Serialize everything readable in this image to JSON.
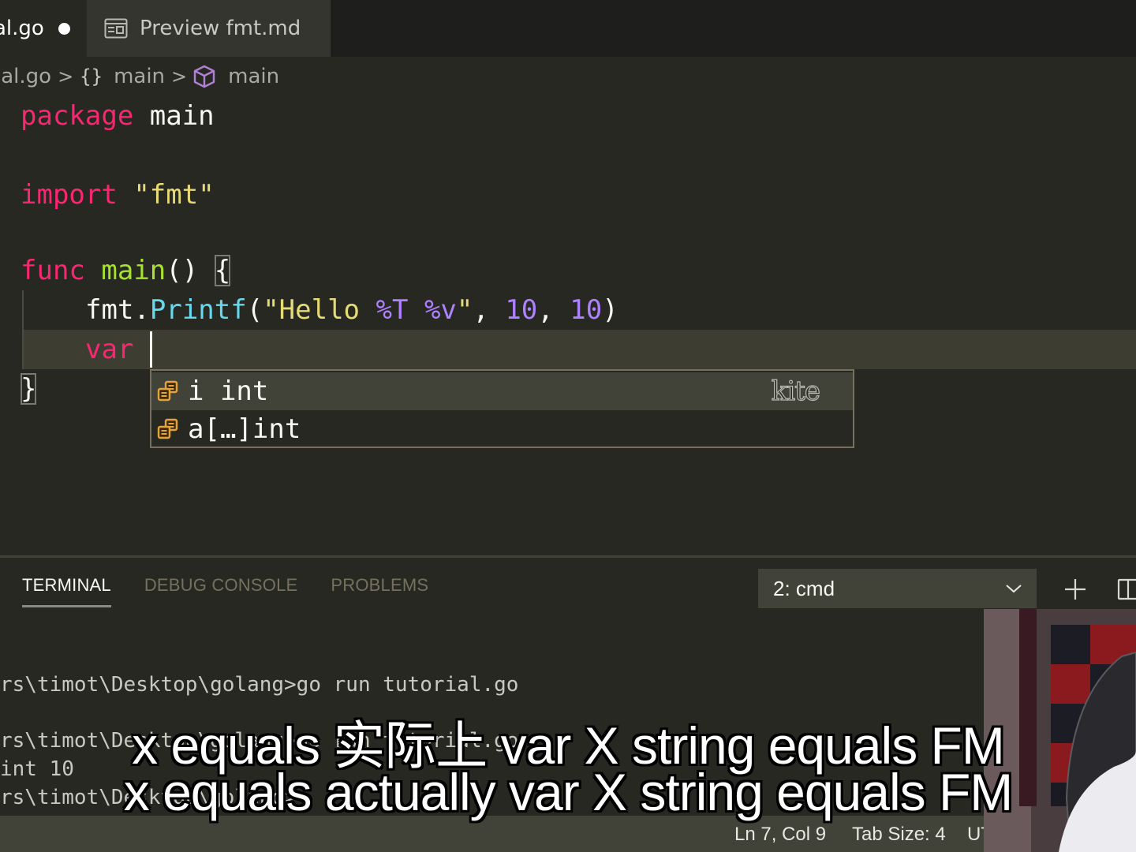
{
  "tabs": [
    {
      "label": "al.go",
      "dirty": true,
      "active": true
    },
    {
      "label": "Preview fmt.md",
      "icon": "preview-icon",
      "active": false
    }
  ],
  "breadcrumb": {
    "file": "ial.go",
    "separator": ">",
    "namespace_icon": "{}",
    "namespace": "main",
    "symbol": "main"
  },
  "editor": {
    "lines": {
      "l1": {
        "kw": "package",
        "rest": " main"
      },
      "l3": {
        "kw": "import",
        "str": "\"fmt\""
      },
      "l5": {
        "kw": "func",
        "fn": "main",
        "parens": "()",
        "brace": "{"
      },
      "l6": {
        "obj": "fmt.",
        "method": "Printf",
        "open": "(",
        "str": "\"Hello ",
        "verb1": "%T",
        "space": " ",
        "verb2": "%v",
        "strEnd": "\"",
        "comma1": ", ",
        "n1": "10",
        "comma2": ", ",
        "n2": "10",
        "close": ")"
      },
      "l7": {
        "kw": "var",
        "rest": " "
      },
      "l8": {
        "brace": "}"
      }
    }
  },
  "suggestions": [
    {
      "label": "i int",
      "source": "kite",
      "icon": "variable-icon",
      "selected": true
    },
    {
      "label": "a[…]int",
      "source": "",
      "icon": "variable-icon",
      "selected": false
    }
  ],
  "panel": {
    "tabs": [
      "TERMINAL",
      "DEBUG CONSOLE",
      "PROBLEMS"
    ],
    "active_tab": "TERMINAL",
    "terminal_select": "2: cmd",
    "terminal_lines": [
      "rs\\timot\\Desktop\\golang>go run tutorial.go",
      "rs\\timot\\Desktop\\golang>go run tutorial.go",
      "int 10",
      "rs\\timot\\Desktop\\golang>"
    ]
  },
  "statusbar": {
    "position": "Ln 7, Col 9",
    "tab_size": "Tab Size: 4",
    "encoding": "UT"
  },
  "subtitles": {
    "line1": "x equals 实际上 var X string equals FM",
    "line2": "x equals actually var X string equals FM"
  },
  "colors": {
    "keyword": "#f92672",
    "function": "#a6e22e",
    "string": "#e6db74",
    "number": "#ae81ff",
    "method": "#66d9ef",
    "background": "#272822",
    "statusbar": "#414339"
  }
}
